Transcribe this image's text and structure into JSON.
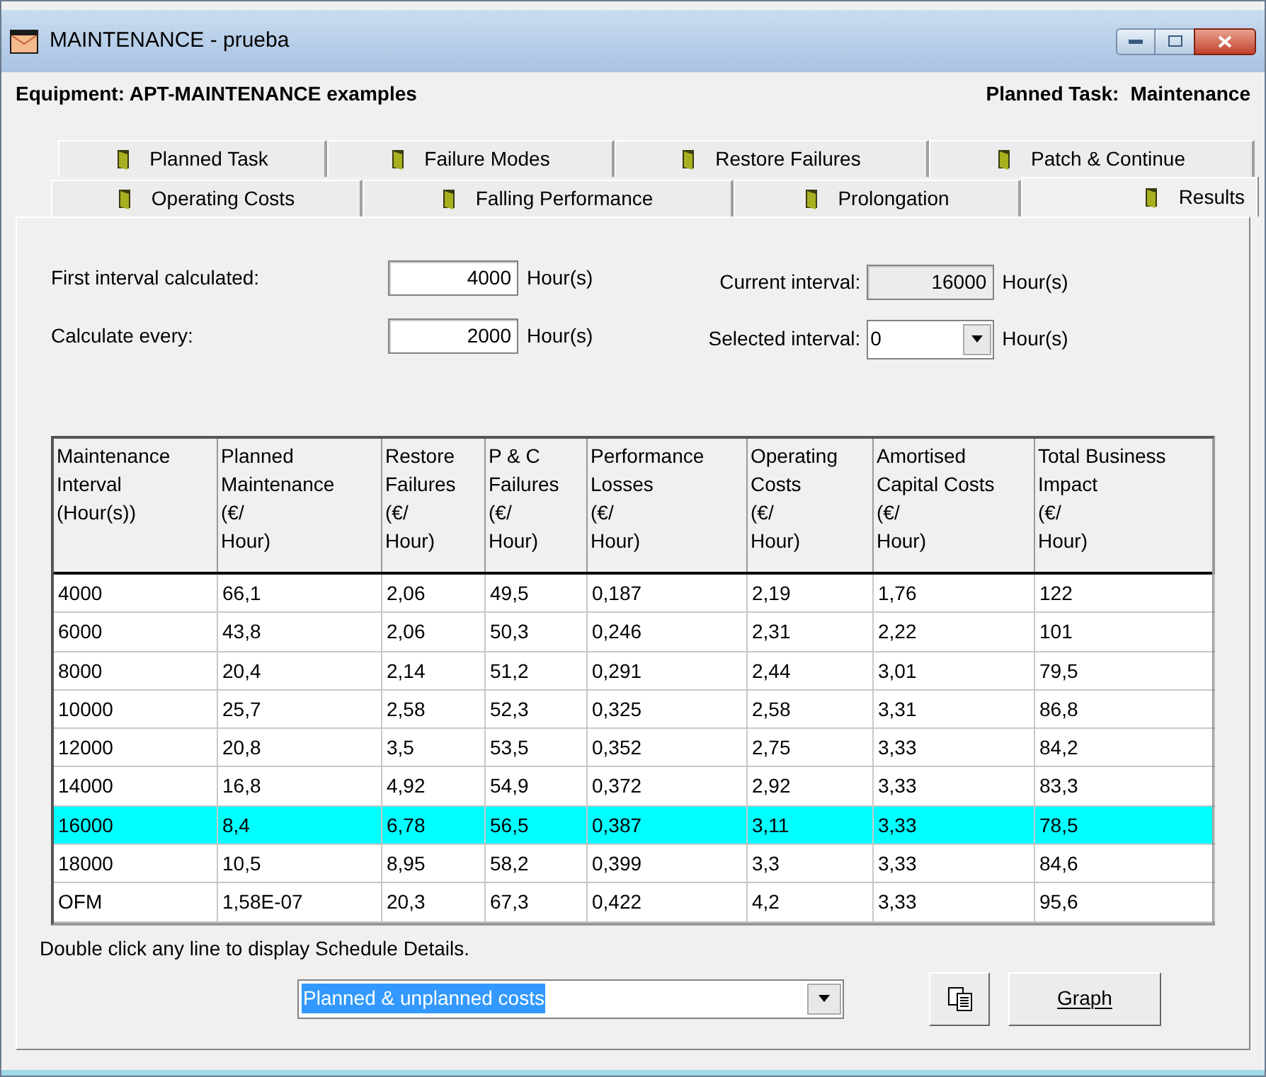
{
  "window": {
    "title": "MAINTENANCE - prueba"
  },
  "header": {
    "equipment": "Equipment: APT-MAINTENANCE examples",
    "planned_task_label": "Planned Task:",
    "planned_task": "Maintenance"
  },
  "tab_rows": [
    [
      {
        "label": "Planned Task",
        "selected": false
      },
      {
        "label": "Failure Modes",
        "selected": false
      },
      {
        "label": "Restore Failures",
        "selected": false
      },
      {
        "label": "Patch & Continue",
        "selected": false
      }
    ],
    [
      {
        "label": "Operating Costs",
        "selected": false
      },
      {
        "label": "Falling Performance",
        "selected": false
      },
      {
        "label": "Prolongation",
        "selected": false
      },
      {
        "label": "Results",
        "selected": true
      }
    ]
  ],
  "fields": {
    "first_interval": {
      "label": "First interval calculated:",
      "value": "4000",
      "unit": "Hour(s)"
    },
    "calculate_every": {
      "label": "Calculate every:",
      "value": "2000",
      "unit": "Hour(s)"
    },
    "current_interval": {
      "label": "Current interval:",
      "value": "16000",
      "unit": "Hour(s)",
      "disabled": true
    },
    "selected_interval": {
      "label": "Selected interval:",
      "value": "0",
      "unit": "Hour(s)"
    }
  },
  "table": {
    "columns": [
      "Maintenance\nInterval\n(Hour(s))",
      "Planned\nMaintenance\n(€/\nHour)",
      "Restore\nFailures\n(€/\nHour)",
      "P & C\nFailures\n(€/\nHour)",
      "Performance\nLosses\n(€/\nHour)",
      "Operating\nCosts\n(€/\nHour)",
      "Amortised\nCapital Costs\n(€/\nHour)",
      "Total Business\nImpact\n(€/\nHour)"
    ],
    "rows": [
      {
        "cells": [
          "4000",
          "66,1",
          "2,06",
          "49,5",
          "0,187",
          "2,19",
          "1,76",
          "122"
        ],
        "selected": false
      },
      {
        "cells": [
          "6000",
          "43,8",
          "2,06",
          "50,3",
          "0,246",
          "2,31",
          "2,22",
          "101"
        ],
        "selected": false
      },
      {
        "cells": [
          "8000",
          "20,4",
          "2,14",
          "51,2",
          "0,291",
          "2,44",
          "3,01",
          "79,5"
        ],
        "selected": false
      },
      {
        "cells": [
          "10000",
          "25,7",
          "2,58",
          "52,3",
          "0,325",
          "2,58",
          "3,31",
          "86,8"
        ],
        "selected": false
      },
      {
        "cells": [
          "12000",
          "20,8",
          "3,5",
          "53,5",
          "0,352",
          "2,75",
          "3,33",
          "84,2"
        ],
        "selected": false
      },
      {
        "cells": [
          "14000",
          "16,8",
          "4,92",
          "54,9",
          "0,372",
          "2,92",
          "3,33",
          "83,3"
        ],
        "selected": false
      },
      {
        "cells": [
          "16000",
          "8,4",
          "6,78",
          "56,5",
          "0,387",
          "3,11",
          "3,33",
          "78,5"
        ],
        "selected": true
      },
      {
        "cells": [
          "18000",
          "10,5",
          "8,95",
          "58,2",
          "0,399",
          "3,3",
          "3,33",
          "84,6"
        ],
        "selected": false
      },
      {
        "cells": [
          "OFM",
          "1,58E-07",
          "20,3",
          "67,3",
          "0,422",
          "4,2",
          "3,33",
          "95,6"
        ],
        "selected": false
      }
    ]
  },
  "note": "Double click any line to display Schedule Details.",
  "chart_selector": {
    "value": "Planned & unplanned costs"
  },
  "graph_button": "Graph"
}
